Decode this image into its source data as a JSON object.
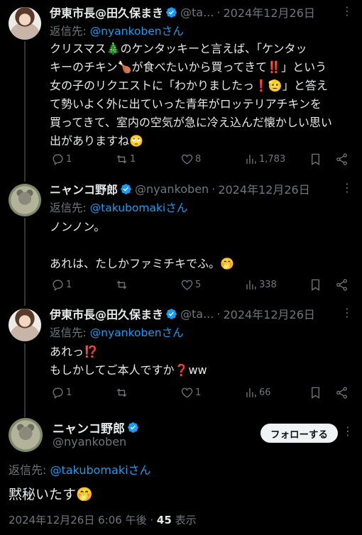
{
  "tweets": [
    {
      "name": "伊東市長@田久保まき",
      "handle": "@ta...",
      "dot": "·",
      "date": "2024年12月26日",
      "reply_prefix": "返信先: ",
      "reply_mention": "@nyankobenさん",
      "lines": [
        "クリスマス🎄のケンタッキーと言えば、「ケンタッ",
        "キーのチキン🍗が食べたいから買ってきて‼️」という",
        "女の子のリクエストに「わかりましたっ❗🫡」と答え",
        "て勢いよく外に出ていった青年がロッテリアチキンを",
        "買ってきて、室内の空気が急に冷え込んだ懐かしい思い",
        "出がありますね🙄"
      ],
      "stats": {
        "replies": "1",
        "reposts": "1",
        "likes": "8",
        "views": "1,783"
      }
    },
    {
      "name": "ニャンコ野郎",
      "handle": "@nyankoben",
      "dot": "·",
      "date": "2024年12月26日",
      "reply_prefix": "返信先: ",
      "reply_mention": "@takubomakiさん",
      "lines": [
        "ノンノン。",
        "",
        "あれは、たしかファミチキでふ。🤭"
      ],
      "stats": {
        "replies": "1",
        "reposts": "",
        "likes": "5",
        "views": "338"
      }
    },
    {
      "name": "伊東市長@田久保まき",
      "handle": "@ta...",
      "dot": "·",
      "date": "2024年12月26日",
      "reply_prefix": "返信先: ",
      "reply_mention": "@nyankobenさん",
      "lines": [
        "あれっ⁉️",
        "もしかしてご本人ですか❓ww"
      ],
      "stats": {
        "replies": "1",
        "reposts": "",
        "likes": "1",
        "views": "66"
      }
    }
  ],
  "main": {
    "name": "ニャンコ野郎",
    "handle": "@nyankoben",
    "follow_label": "フォローする",
    "reply_prefix": "返信先: ",
    "reply_mention": "@takubomakiさん",
    "text": "黙秘いたす🤭",
    "timestamp": "2024年12月26日 6:06 午後",
    "dot": "·",
    "views_count": "45",
    "views_label": "表示"
  },
  "colors": {
    "accent": "#1d9bf0",
    "muted": "#71767b",
    "text": "#e7e9ea",
    "background": "#000000"
  },
  "icons": [
    "verified-badge-icon",
    "more-icon",
    "reply-icon",
    "repost-icon",
    "like-icon",
    "views-icon",
    "bookmark-icon",
    "share-icon"
  ]
}
